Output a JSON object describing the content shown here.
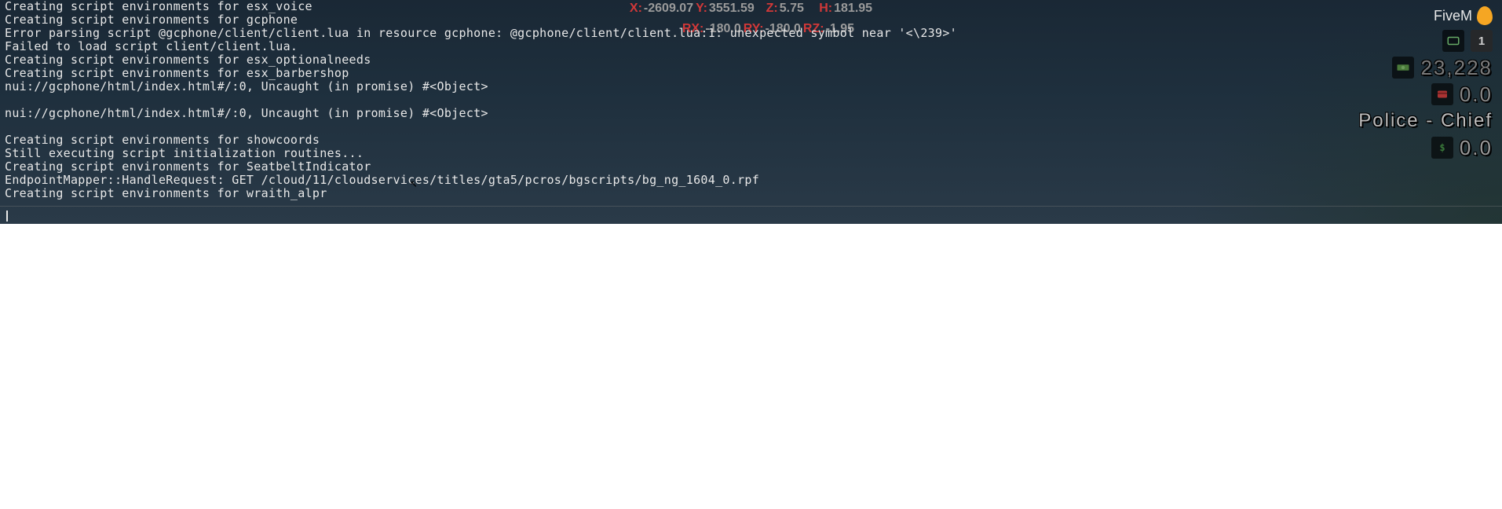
{
  "brand": {
    "name": "FiveM",
    "icon": "snail-icon"
  },
  "cursor": {
    "glyph": "↖"
  },
  "coords": {
    "row1": [
      {
        "label": "X:",
        "value": "-2609.07"
      },
      {
        "label": "Y:",
        "value": "3551.59"
      },
      {
        "label": "Z:",
        "value": "5.75"
      },
      {
        "label": "H:",
        "value": "181.95"
      }
    ],
    "row2": [
      {
        "label": "RX:",
        "value": "-180.0"
      },
      {
        "label": "RY:",
        "value": "-180.0"
      },
      {
        "label": "RZ:",
        "value": "-1.95"
      }
    ]
  },
  "hud": {
    "id": "1",
    "cash": "23,228",
    "bank": "0.0",
    "job": "Police - Chief",
    "black_money": "0.0"
  },
  "console": {
    "lines": [
      "Creating script environments for esx_voice",
      "Creating script environments for gcphone",
      "Error parsing script @gcphone/client/client.lua in resource gcphone: @gcphone/client/client.lua:1: unexpected symbol near '<\\239>'",
      "Failed to load script client/client.lua.",
      "Creating script environments for esx_optionalneeds",
      "Creating script environments for esx_barbershop",
      "nui://gcphone/html/index.html#/:0, Uncaught (in promise) #<Object>",
      "",
      "nui://gcphone/html/index.html#/:0, Uncaught (in promise) #<Object>",
      "",
      "Creating script environments for showcoords",
      "Still executing script initialization routines...",
      "Creating script environments for SeatbeltIndicator",
      "EndpointMapper::HandleRequest: GET /cloud/11/cloudservices/titles/gta5/pcros/bgscripts/bg_ng_1604_0.rpf",
      "Creating script environments for wraith_alpr"
    ]
  }
}
